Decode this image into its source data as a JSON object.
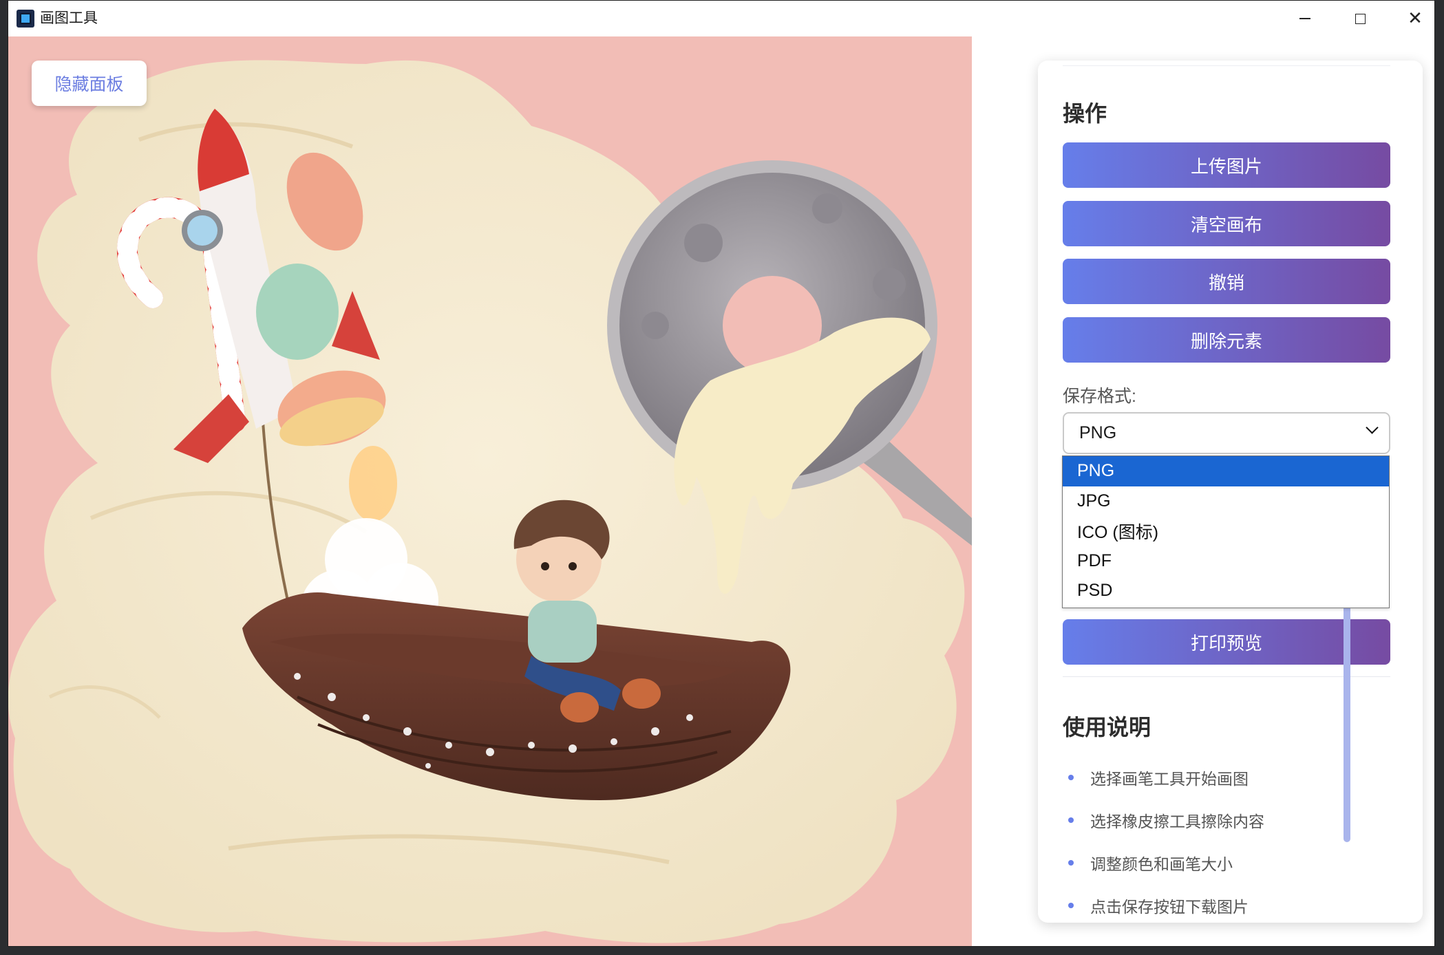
{
  "window": {
    "title": "画图工具",
    "controls": {
      "minimize": "minimize-icon",
      "maximize": "maximize-icon",
      "close": "close-icon"
    }
  },
  "canvas": {
    "hide_panel_label": "隐藏面板"
  },
  "panel": {
    "operations_title": "操作",
    "buttons": [
      {
        "label": "上传图片"
      },
      {
        "label": "清空画布"
      },
      {
        "label": "撤销"
      },
      {
        "label": "删除元素"
      }
    ],
    "format_label": "保存格式:",
    "format_selected": "PNG",
    "format_options": [
      "PNG",
      "JPG",
      "ICO (图标)",
      "PDF",
      "PSD"
    ],
    "print_preview_label": "打印预览",
    "help_title": "使用说明",
    "help_items": [
      "选择画笔工具开始画图",
      "选择橡皮擦工具擦除内容",
      "调整颜色和画笔大小",
      "点击保存按钮下载图片"
    ]
  },
  "colors": {
    "accent_start": "#667eea",
    "accent_end": "#764ba2",
    "dropdown_highlight": "#1a66d2"
  }
}
